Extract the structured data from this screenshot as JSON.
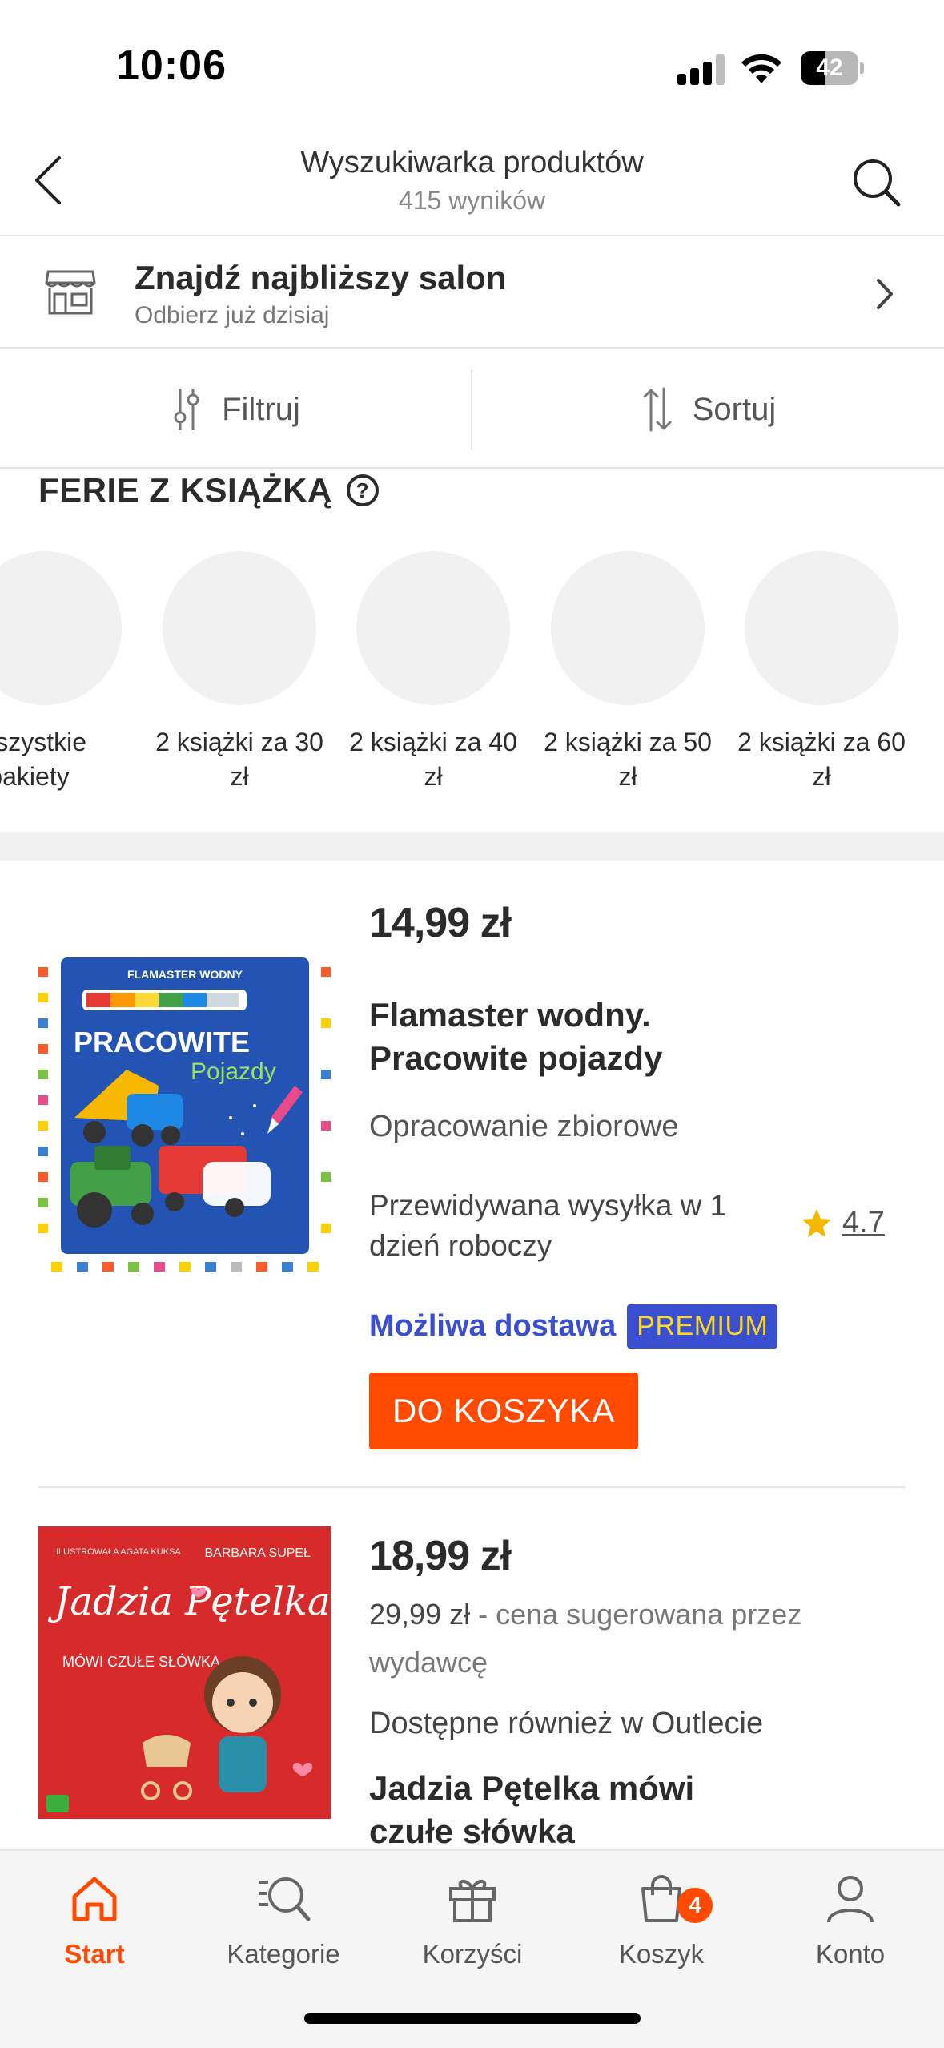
{
  "status_bar": {
    "time": "10:06",
    "battery": "42",
    "battery_level": 0.42
  },
  "header": {
    "title": "Wyszukiwarka produktów",
    "subtitle": "415 wyników",
    "back_icon": "chevron-left-icon",
    "search_icon": "search-icon"
  },
  "store": {
    "title": "Znajdź najbliższy salon",
    "subtitle": "Odbierz już dzisiaj",
    "icon": "store-icon"
  },
  "toolbar": {
    "filter_label": "Filtruj",
    "sort_label": "Sortuj"
  },
  "promo": {
    "title": "FERIE Z KSIĄŻKĄ",
    "help": "?",
    "items": [
      {
        "label": "Wszystkie pakiety"
      },
      {
        "label": "2 książki za 30 zł"
      },
      {
        "label": "2 książki za 40 zł"
      },
      {
        "label": "2 książki za 50 zł"
      },
      {
        "label": "2 książki za 60 zł"
      }
    ]
  },
  "products": [
    {
      "price": "14,99 zł",
      "name": "Flamaster wodny. Pracowite pojazdy",
      "author": "Opracowanie zbiorowe",
      "shipping": "Przewidywana wysyłka w 1 dzień roboczy",
      "rating": "4.7",
      "delivery_label": "Możliwa dostawa",
      "delivery_badge": "PREMIUM",
      "add_to_cart": "DO KOSZYKA",
      "cover": {
        "top_label": "FLAMASTER WODNY",
        "title1": "PRACOWITE",
        "title2": "Pojazdy"
      }
    },
    {
      "price": "18,99 zł",
      "old_price": "29,99 zł",
      "old_price_note": " - cena sugerowana przez wydawcę",
      "outlet": "Dostępne również w Outlecie",
      "name": "Jadzia Pętelka mówi czułe słówka",
      "cover": {
        "illustrator": "ILUSTROWAŁA AGATA KUKSA",
        "author": "BARBARA SUPEŁ",
        "title": "Jadzia Pętelka",
        "subtitle": "MÓWI CZUŁE SŁÓWKA"
      }
    }
  ],
  "tabs": [
    {
      "label": "Start",
      "icon": "home-icon",
      "active": true
    },
    {
      "label": "Kategorie",
      "icon": "categories-search-icon"
    },
    {
      "label": "Korzyści",
      "icon": "gift-icon"
    },
    {
      "label": "Koszyk",
      "icon": "cart-bag-icon",
      "badge": "4"
    },
    {
      "label": "Konto",
      "icon": "user-icon"
    }
  ],
  "colors": {
    "accent": "#ff4a00",
    "premium_blue": "#3a4fd0",
    "premium_text": "#ffd81e",
    "rating_star": "#f5b800"
  }
}
